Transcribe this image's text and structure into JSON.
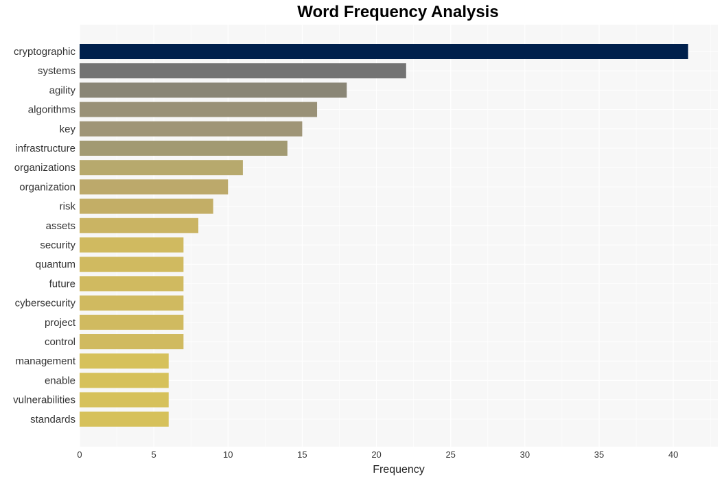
{
  "chart_data": {
    "type": "bar",
    "orientation": "horizontal",
    "title": "Word Frequency Analysis",
    "xlabel": "Frequency",
    "ylabel": "",
    "xlim": [
      0,
      43
    ],
    "xticks": [
      0,
      5,
      10,
      15,
      20,
      25,
      30,
      35,
      40
    ],
    "grid": true,
    "categories": [
      "cryptographic",
      "systems",
      "agility",
      "algorithms",
      "key",
      "infrastructure",
      "organizations",
      "organization",
      "risk",
      "assets",
      "security",
      "quantum",
      "future",
      "cybersecurity",
      "project",
      "control",
      "management",
      "enable",
      "vulnerabilities",
      "standards"
    ],
    "values": [
      41,
      22,
      18,
      16,
      15,
      14,
      11,
      10,
      9,
      8,
      7,
      7,
      7,
      7,
      7,
      7,
      6,
      6,
      6,
      6
    ],
    "colors": [
      "#00204c",
      "#737373",
      "#8a8676",
      "#999177",
      "#9f9577",
      "#a29a72",
      "#b7a96d",
      "#bca96b",
      "#c3ae66",
      "#cab463",
      "#d0ba60",
      "#d0ba60",
      "#d0ba60",
      "#d0ba60",
      "#d0ba60",
      "#d0ba60",
      "#d6c15b",
      "#d6c15b",
      "#d6c15b",
      "#d6c15b"
    ],
    "plot_background": "#f7f7f7"
  }
}
